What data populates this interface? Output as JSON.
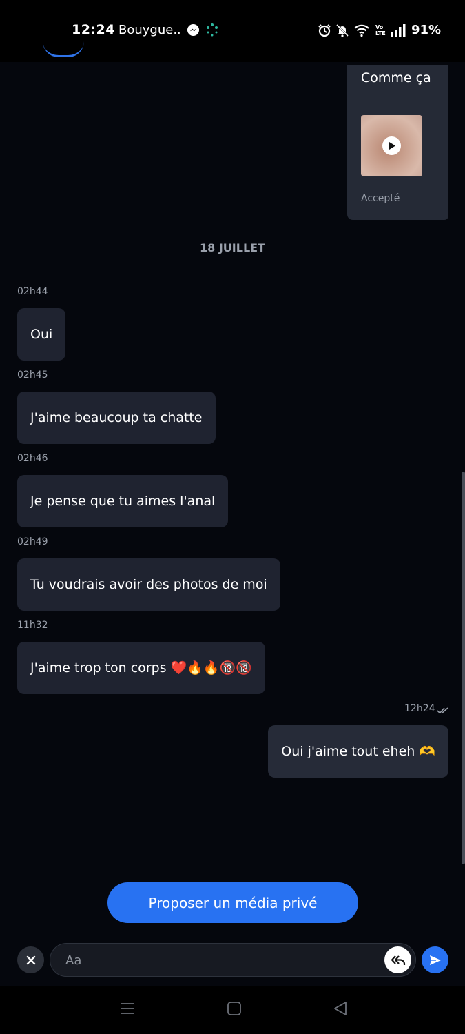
{
  "status_bar": {
    "time": "12:24",
    "carrier": "Bouygue..",
    "battery": "91%",
    "icons": [
      "messenger-icon",
      "dots-icon",
      "alarm-icon",
      "mute-icon",
      "wifi-icon",
      "volte-icon",
      "signal-icon"
    ]
  },
  "media_card": {
    "caption": "Comme ça",
    "status": "Accepté"
  },
  "date_separator": "18 JUILLET",
  "messages": [
    {
      "time": "02h44",
      "text": "Oui",
      "direction": "incoming"
    },
    {
      "time": "02h45",
      "text": "J'aime beaucoup ta chatte",
      "direction": "incoming"
    },
    {
      "time": "02h46",
      "text": "Je pense que tu aimes l'anal",
      "direction": "incoming"
    },
    {
      "time": "02h49",
      "text": "Tu voudrais avoir des photos de moi",
      "direction": "incoming"
    },
    {
      "time": "11h32",
      "text": "J'aime trop ton corps ❤️🔥🔥🔞🔞",
      "direction": "incoming"
    },
    {
      "time": "12h24",
      "text": "Oui j'aime tout eheh 🫶",
      "direction": "outgoing",
      "read": true
    }
  ],
  "propose_button": "Proposer un média privé",
  "composer": {
    "placeholder": "Aa"
  },
  "colors": {
    "background": "#05070d",
    "bubble": "#1f2330",
    "accent": "#2872f2",
    "muted_text": "#9aa0ab"
  }
}
